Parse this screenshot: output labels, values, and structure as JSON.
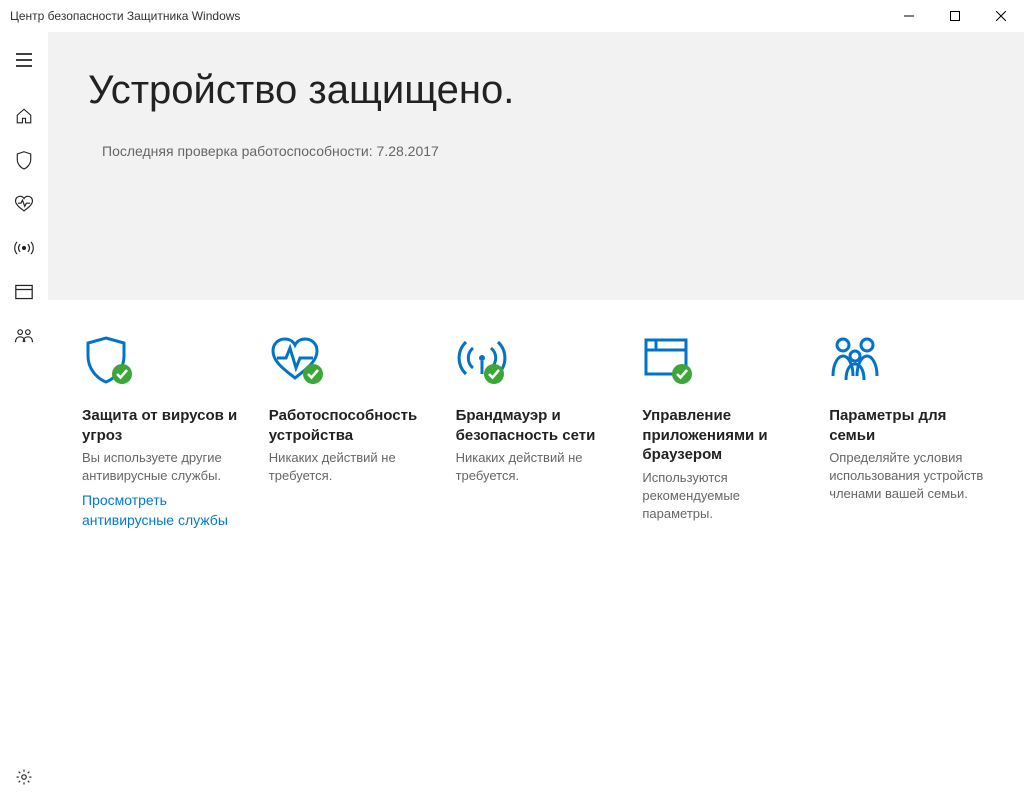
{
  "window": {
    "title": "Центр безопасности Защитника Windows"
  },
  "hero": {
    "title": "Устройство защищено.",
    "subtitle": "Последняя проверка работоспособности:  7.28.2017"
  },
  "cards": [
    {
      "title": "Защита от вирусов и угроз",
      "desc": "Вы используете другие антивирусные службы.",
      "link": "Просмотреть антивирусные службы"
    },
    {
      "title": "Работоспособность устройства",
      "desc": "Никаких действий не требуется.",
      "link": ""
    },
    {
      "title": "Брандмауэр и безопасность сети",
      "desc": "Никаких действий не требуется.",
      "link": ""
    },
    {
      "title": "Управление приложениями и браузером",
      "desc": "Используются рекомендуемые параметры.",
      "link": ""
    },
    {
      "title": "Параметры для семьи",
      "desc": "Определяйте условия использования устройств членами вашей семьи.",
      "link": ""
    }
  ]
}
